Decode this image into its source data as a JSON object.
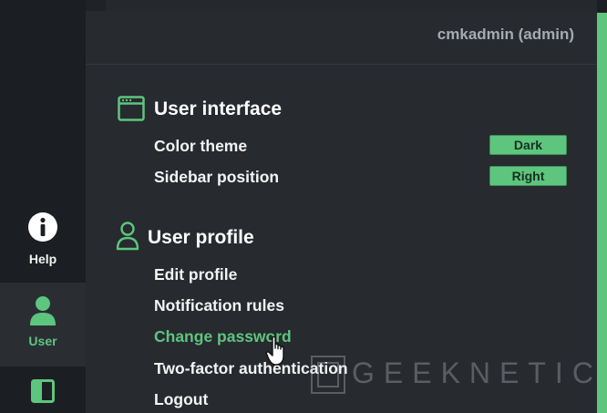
{
  "header": {
    "user": "cmkadmin (admin)"
  },
  "nav": {
    "help": {
      "label": "Help",
      "icon": "info-circle-icon"
    },
    "user": {
      "label": "User",
      "icon": "user-icon"
    },
    "sidebar": {
      "icon": "sidebar-panel-icon"
    }
  },
  "ui_section": {
    "title": "User interface",
    "icon": "window-icon",
    "items": [
      {
        "label": "Color theme",
        "value": "Dark"
      },
      {
        "label": "Sidebar position",
        "value": "Right"
      }
    ]
  },
  "profile_section": {
    "title": "User profile",
    "icon": "user-outline-icon",
    "items": [
      {
        "label": "Edit profile"
      },
      {
        "label": "Notification rules"
      },
      {
        "label": "Change password"
      },
      {
        "label": "Two-factor authentication"
      },
      {
        "label": "Logout"
      }
    ]
  },
  "watermark": {
    "text": "GEEKNETIC"
  },
  "colors": {
    "accent": "#5ec57e",
    "background": "#25282d",
    "rail": "#1b1e22"
  }
}
